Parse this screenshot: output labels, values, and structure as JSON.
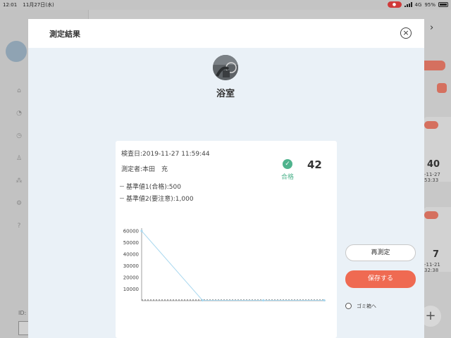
{
  "statusbar": {
    "time": "12:01",
    "date": "11月27日(水)",
    "network": "4G",
    "battery": "95%"
  },
  "background": {
    "id_label": "ID:",
    "cards": [
      {
        "number": "40",
        "date": "-11-27",
        "time": "53:33"
      },
      {
        "number": "7",
        "date": "-11-21",
        "time": "32:38"
      }
    ]
  },
  "modal": {
    "title": "測定結果",
    "place_name": "浴室",
    "inspection_date": "検査日:2019-11-27 11:59:44",
    "measurer": "測定者:本田　充",
    "result_label": "合格",
    "score": "42",
    "legend": [
      "基準値1(合格):500",
      "基準値2(要注意):1,000"
    ],
    "remeasure_button": "再測定",
    "save_button": "保存する",
    "trash_label": "ゴミ箱へ"
  },
  "colors": {
    "accent": "#ef6a52",
    "pass": "#4fb38d",
    "line": "#a9d8ef"
  },
  "chart_data": {
    "type": "line",
    "x": [
      0,
      1,
      2,
      3
    ],
    "series": [
      {
        "values": [
          60000,
          300,
          300,
          300
        ]
      }
    ],
    "ylim": [
      0,
      60000
    ],
    "yticks": [
      10000,
      20000,
      30000,
      40000,
      50000,
      60000
    ],
    "reference_lines": [
      500,
      1000
    ]
  }
}
